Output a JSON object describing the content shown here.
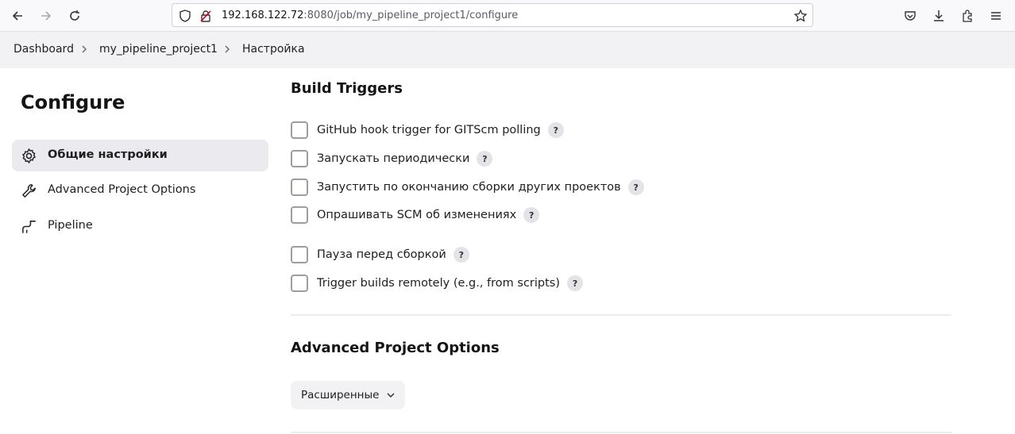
{
  "browser": {
    "url_host": "192.168.122.72",
    "url_rest": ":8080/job/my_pipeline_project1/configure"
  },
  "breadcrumb": {
    "items": [
      "Dashboard",
      "my_pipeline_project1",
      "Настройка"
    ]
  },
  "sidebar": {
    "title": "Configure",
    "items": [
      {
        "label": "Общие настройки",
        "icon": "gear-icon",
        "active": true
      },
      {
        "label": "Advanced Project Options",
        "icon": "wrench-icon",
        "active": false
      },
      {
        "label": "Pipeline",
        "icon": "pipeline-icon",
        "active": false
      }
    ]
  },
  "build_triggers": {
    "title": "Build Triggers",
    "help_label": "?",
    "items": [
      {
        "label": "GitHub hook trigger for GITScm polling",
        "checked": false
      },
      {
        "label": "Запускать периодически",
        "checked": false
      },
      {
        "label": "Запустить по окончанию сборки других проектов",
        "checked": false
      },
      {
        "label": "Опрашивать SCM об изменениях",
        "checked": false
      },
      {
        "label": "Пауза перед сборкой",
        "checked": false
      },
      {
        "label": "Trigger builds remotely (e.g., from scripts)",
        "checked": false
      }
    ]
  },
  "advanced_options": {
    "title": "Advanced Project Options",
    "button_label": "Расширенные"
  }
}
